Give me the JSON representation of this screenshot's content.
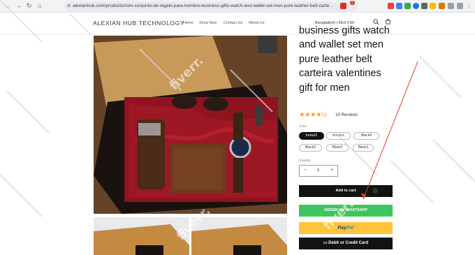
{
  "browser": {
    "url": "alexianhub.com/products/com-conjunto-de-regalo-para-hombre-business-gifts-watch-and-wallet-set-men-pure-leather-belt-carte...",
    "back_icon": "arrow-left-icon",
    "forward_icon": "arrow-right-icon",
    "reload_icon": "reload-icon",
    "extension_badge": "2"
  },
  "header": {
    "brand": "ALEXIAN HUB TECHNOLOGY",
    "menu": [
      "Home",
      "Shop Now",
      "Contact Us",
      "About Us"
    ],
    "locale": "Bangladesh | KES KSh",
    "search_icon": "search-icon",
    "cart_icon": "cart-icon"
  },
  "product": {
    "title_lines": [
      "business gifts watch",
      "and wallet set men",
      "pure leather belt",
      "carteira valentines",
      "gift for men"
    ],
    "rating_stars": "★★★★½",
    "rating_value": 4.5,
    "reviews": "10 Reviews",
    "color_label": "Color",
    "swatches": [
      {
        "label": "brown2",
        "active": true
      },
      {
        "label": "brown1",
        "active": false
      },
      {
        "label": "Black4",
        "active": false
      },
      {
        "label": "Black3",
        "active": false
      },
      {
        "label": "Black2",
        "active": false
      },
      {
        "label": "Black1",
        "active": false
      }
    ],
    "quantity_label": "Quantity",
    "quantity_value": "1",
    "minus": "−",
    "plus": "+",
    "add_to_cart": "Add to cart",
    "order_whatsapp": "ORDER ON WHATSAPP",
    "paypal_pay": "Pay",
    "paypal_pal": "Pal",
    "card_button": "Debit or Credit Card"
  },
  "watermark": "fiverr.",
  "colors": {
    "whatsapp": "#40c55e",
    "paypal": "#ffc439",
    "stars": "#f0a020",
    "annotation_arrow": "#e53935"
  }
}
